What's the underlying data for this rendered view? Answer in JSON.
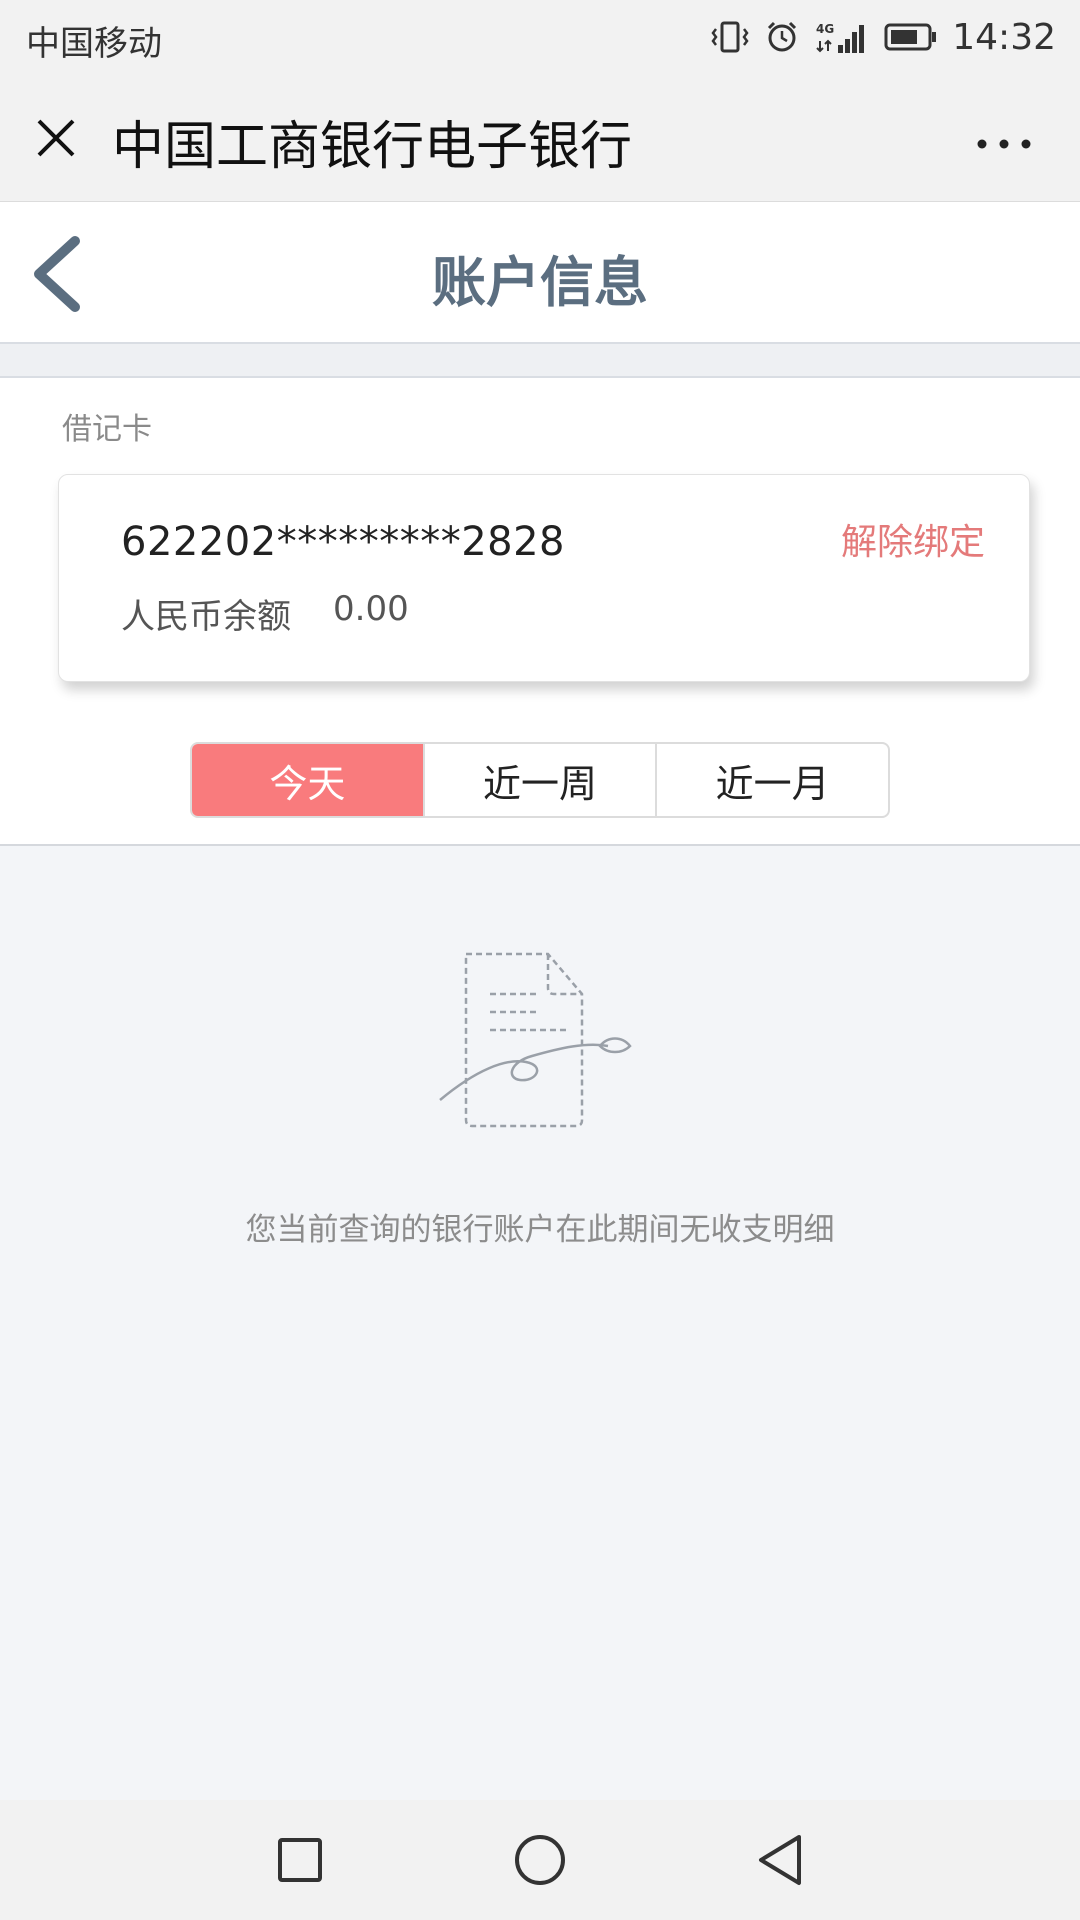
{
  "status_bar": {
    "carrier": "中国移动",
    "time": "14:32",
    "network": "4G"
  },
  "titlebar": {
    "title": "中国工商银行电子银行",
    "more_label": "···"
  },
  "header": {
    "title": "账户信息"
  },
  "card_section": {
    "card_type": "借记卡",
    "card_number": "622202*********2828",
    "unbind_label": "解除绑定",
    "balance_label": "人民币余额",
    "balance_value": "0.00"
  },
  "period_tabs": {
    "selected": "今天",
    "items": [
      {
        "label": "今天"
      },
      {
        "label": "近一周"
      },
      {
        "label": "近一月"
      }
    ]
  },
  "empty_state": {
    "message": "您当前查询的银行账户在此期间无收支明细"
  },
  "colors": {
    "accent": "#f97b7d",
    "unbind": "#e47a7a",
    "title": "#5b6e80",
    "background": "#f3f5f8"
  }
}
